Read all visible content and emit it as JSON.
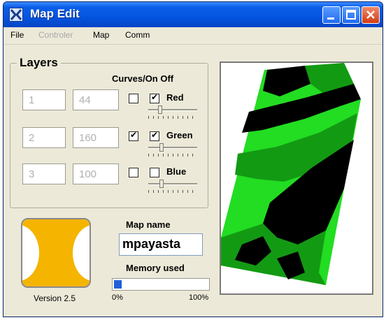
{
  "window": {
    "title": "Map Edit",
    "title_icon": "app-logo-icon",
    "controls": [
      "minimize-icon",
      "maximize-icon",
      "close-icon"
    ]
  },
  "menu": {
    "items": [
      {
        "label": "File",
        "enabled": true
      },
      {
        "label": "Controler",
        "enabled": false
      },
      {
        "label": "Map",
        "enabled": true
      },
      {
        "label": "Comm",
        "enabled": true
      }
    ]
  },
  "layers": {
    "title": "Layers",
    "curves_label": "Curves/On Off",
    "rows": [
      {
        "index_value": "1",
        "value": "44",
        "curve_checked": false,
        "on_checked": true,
        "color_label": "Red",
        "slider_level": 0.2
      },
      {
        "index_value": "2",
        "value": "160",
        "curve_checked": true,
        "on_checked": true,
        "color_label": "Green",
        "slider_level": 0.25
      },
      {
        "index_value": "3",
        "value": "100",
        "curve_checked": false,
        "on_checked": false,
        "color_label": "Blue",
        "slider_level": 0.25
      }
    ]
  },
  "logo": {
    "icon": "yellow-x-logo-icon",
    "colors": {
      "primary": "#f5b400",
      "background": "#ffffff"
    }
  },
  "version_label": "Version 2.5",
  "map_name": {
    "label": "Map name",
    "value": "mpayasta"
  },
  "memory": {
    "label": "Memory used",
    "level": 0.08,
    "min_label": "0%",
    "max_label": "100%"
  },
  "map_preview": {
    "colors": {
      "light_green": "#22dd22",
      "dark_green": "#139a13",
      "black": "#000000"
    }
  },
  "colors": {
    "titlebar": "#0454e0",
    "window_bg": "#ece9d8",
    "progress": "#1f5fd8",
    "disabled_text": "#a8a8a8"
  }
}
